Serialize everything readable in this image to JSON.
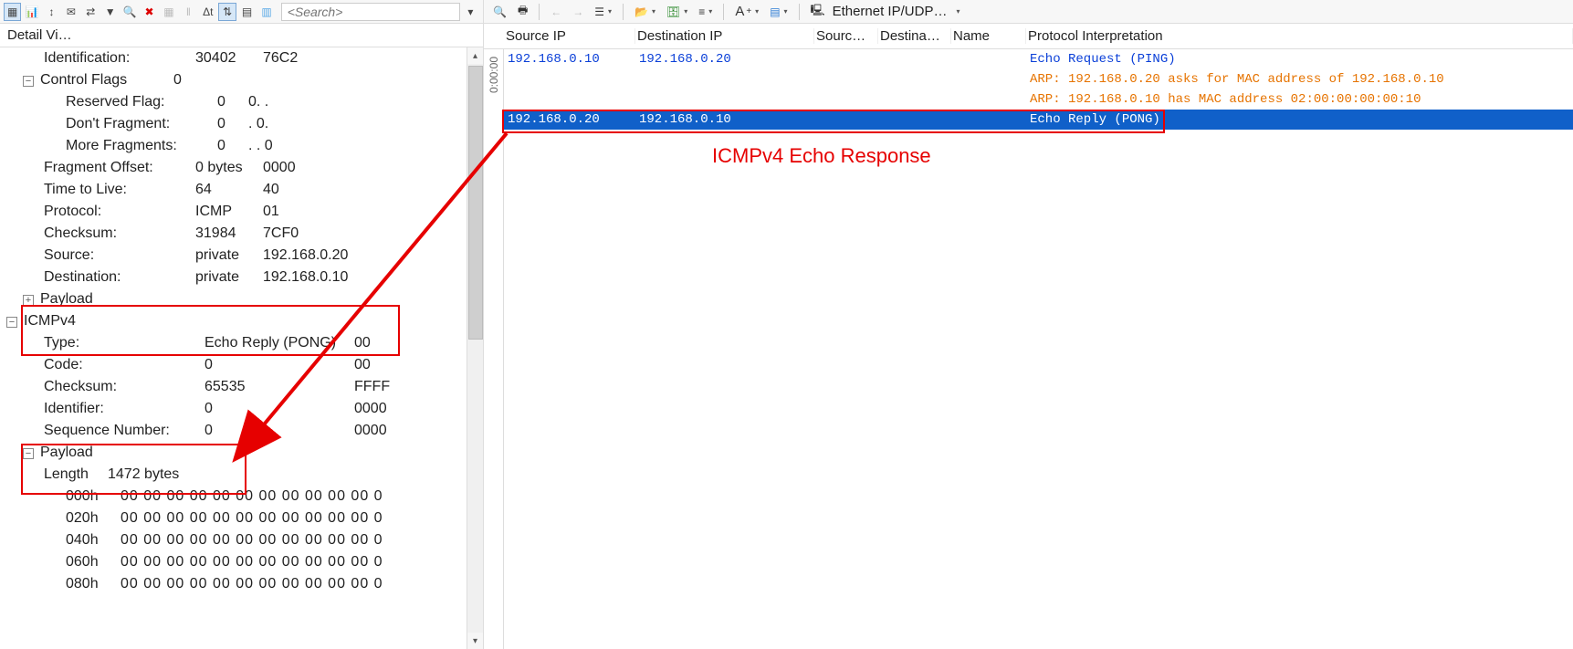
{
  "left_toolbar": {
    "search_placeholder": "<Search>"
  },
  "detail_header": "Detail Vi…",
  "ip": {
    "identification": {
      "label": "Identification:",
      "v1": "30402",
      "v2": "76C2"
    },
    "control_flags": {
      "label": "Control Flags",
      "v1": "0"
    },
    "reserved_flag": {
      "label": "Reserved Flag:",
      "v1": "0",
      "v2": "0. ."
    },
    "dont_fragment": {
      "label": "Don't Fragment:",
      "v1": "0",
      "v2": ". 0."
    },
    "more_fragments": {
      "label": "More Fragments:",
      "v1": "0",
      "v2": ". . 0"
    },
    "fragment_offset": {
      "label": "Fragment Offset:",
      "v1": "0 bytes",
      "v2": "0000"
    },
    "ttl": {
      "label": "Time to Live:",
      "v1": "64",
      "v2": "40"
    },
    "protocol": {
      "label": "Protocol:",
      "v1": "ICMP",
      "v2": "01"
    },
    "checksum": {
      "label": "Checksum:",
      "v1": "31984",
      "v2": "7CF0"
    },
    "source": {
      "label": "Source:",
      "v1": "private",
      "v2": "192.168.0.20"
    },
    "destination": {
      "label": "Destination:",
      "v1": "private",
      "v2": "192.168.0.10"
    },
    "payload": {
      "label": "Payload"
    }
  },
  "icmp": {
    "header": "ICMPv4",
    "type": {
      "label": "Type:",
      "v1": "Echo Reply (PONG)",
      "v2": "00"
    },
    "code": {
      "label": "Code:",
      "v1": "0",
      "v2": "00"
    },
    "checksum": {
      "label": "Checksum:",
      "v1": "65535",
      "v2": "FFFF"
    },
    "identifier": {
      "label": "Identifier:",
      "v1": "0",
      "v2": "0000"
    },
    "sequence": {
      "label": "Sequence Number:",
      "v1": "0",
      "v2": "0000"
    }
  },
  "payload": {
    "header": "Payload",
    "length": {
      "label": "Length",
      "v1": "1472 bytes"
    },
    "rows": [
      {
        "offset": "000h",
        "bytes": "00 00 00 00  00 00 00 00  00 00 00 0"
      },
      {
        "offset": "020h",
        "bytes": "00 00 00 00  00 00 00 00  00 00 00 0"
      },
      {
        "offset": "040h",
        "bytes": "00 00 00 00  00 00 00 00  00 00 00 0"
      },
      {
        "offset": "060h",
        "bytes": "00 00 00 00  00 00 00 00  00 00 00 0"
      },
      {
        "offset": "080h",
        "bytes": "00 00 00 00  00 00 00 00  00 00 00 0"
      }
    ]
  },
  "right_toolbar": {
    "ethernet_label": "Ethernet IP/UDP…"
  },
  "packet_headers": {
    "srcip": "Source IP",
    "dstip": "Destination IP",
    "srcp": "Sourc…",
    "dstp": "Destina…",
    "name": "Name",
    "proto": "Protocol Interpretation"
  },
  "time_gutter": "0:00:00",
  "packets": [
    {
      "cls": "blue",
      "srcip": "192.168.0.10",
      "dstip": "192.168.0.20",
      "srcp": "",
      "dstp": "",
      "name": "",
      "proto": "Echo Request (PING)"
    },
    {
      "cls": "orange",
      "srcip": "",
      "dstip": "",
      "srcp": "",
      "dstp": "",
      "name": "",
      "proto": "ARP: 192.168.0.20 asks for MAC address of 192.168.0.10"
    },
    {
      "cls": "orange",
      "srcip": "",
      "dstip": "",
      "srcp": "",
      "dstp": "",
      "name": "",
      "proto": "ARP: 192.168.0.10 has MAC address 02:00:00:00:00:10"
    },
    {
      "cls": "selected",
      "srcip": "192.168.0.20",
      "dstip": "192.168.0.10",
      "srcp": "",
      "dstp": "",
      "name": "",
      "proto": "Echo Reply (PONG)"
    }
  ],
  "annotation_label": "ICMPv4 Echo Response"
}
